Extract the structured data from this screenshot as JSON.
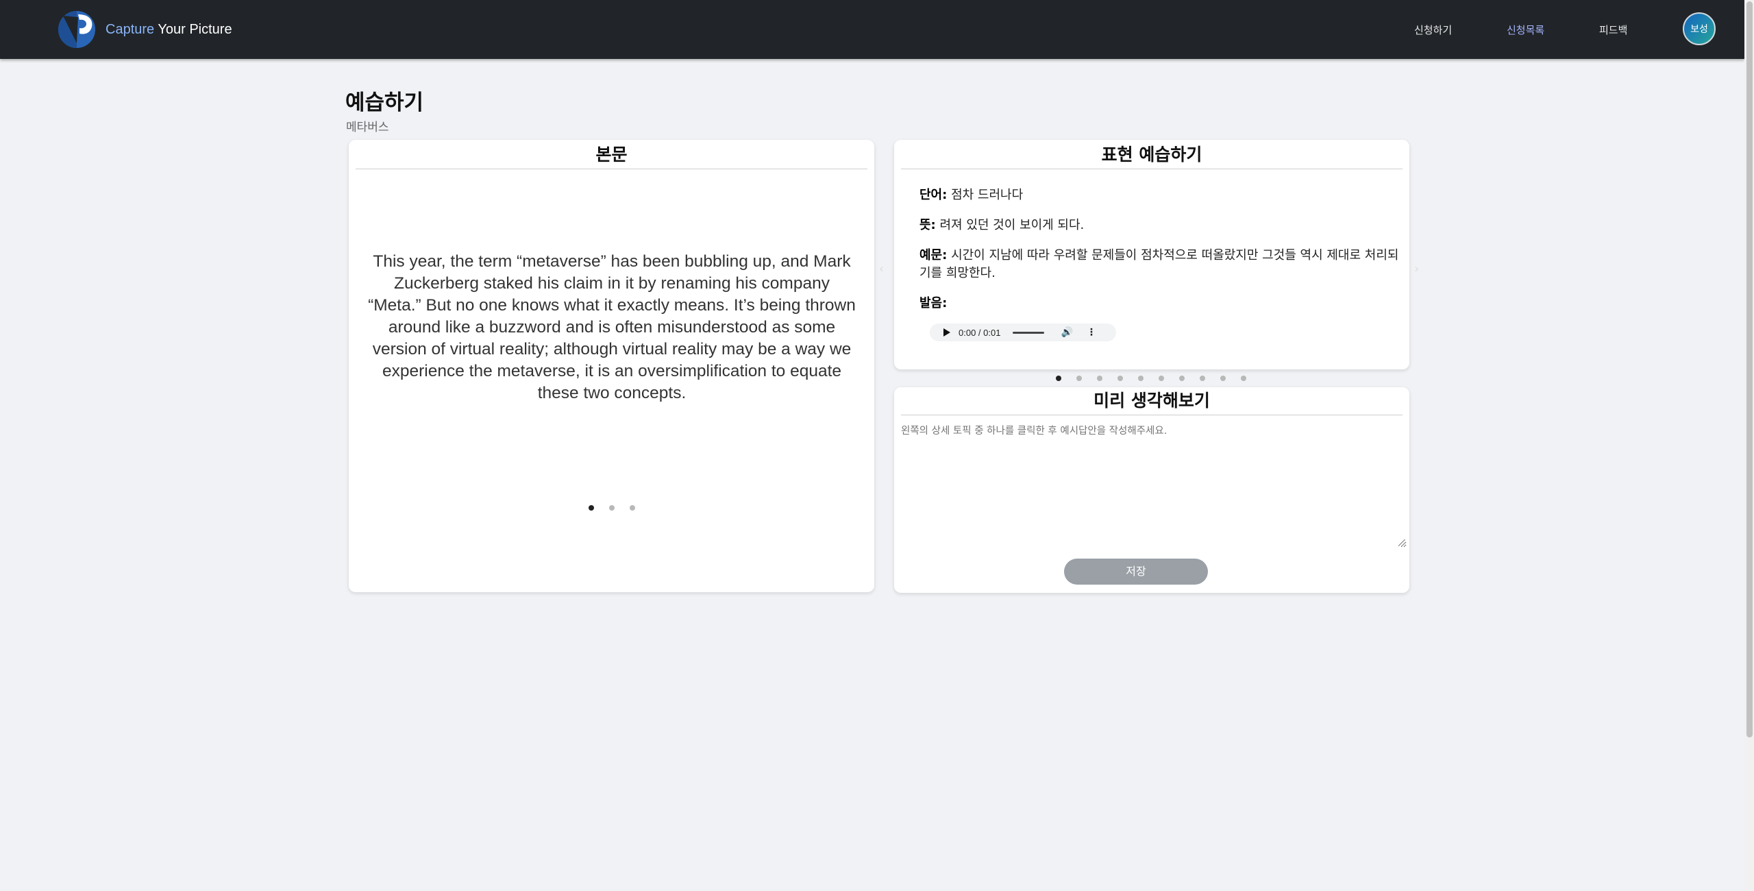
{
  "brand": {
    "name_prefix": "Capt",
    "name_accent_word": "ure",
    "name_rest": " Your Picture"
  },
  "nav": {
    "apply": "신청하기",
    "applications": "신청목록",
    "feedback": "피드백",
    "user": "보성"
  },
  "page": {
    "title": "예습하기",
    "subtitle": "메타버스"
  },
  "passage_card": {
    "header": "본문",
    "text": "This year, the term “metaverse” has been bubbling up, and Mark Zuckerberg staked his claim in it by renaming his company “Meta.” But no one knows what it exactly means. It’s being thrown around like a buzzword and is often misunderstood as some version of virtual reality; although virtual reality may be a way we experience the metaverse, it is an oversimplification to equate these two concepts.",
    "slide_count": 3,
    "active_slide": 1
  },
  "expression_card": {
    "header": "표현 예습하기",
    "word_label": "단어:",
    "word": "점차 드러나다",
    "meaning_label": "뜻:",
    "meaning": "려져 있던 것이 보이게 되다.",
    "example_label": "예문:",
    "example": "시간이 지남에 따라 우려할 문제들이 점차적으로 떠올랐지만 그것들 역시 제대로 처리되기를 희망한다.",
    "pronunciation_label": "발음:",
    "audio_time": "0:00 / 0:01",
    "slide_count": 10,
    "active_slide": 1
  },
  "think_card": {
    "header": "미리 생각해보기",
    "placeholder": "왼쪽의 상세 토픽 중 하나를 클릭한 후 예시답안을 작성해주세요.",
    "save_label": "저장"
  },
  "colors": {
    "navbar": "#212529",
    "active_nav": "#a5b4fc",
    "save_button": "#9aa0a6",
    "background": "#f0f2f5"
  }
}
